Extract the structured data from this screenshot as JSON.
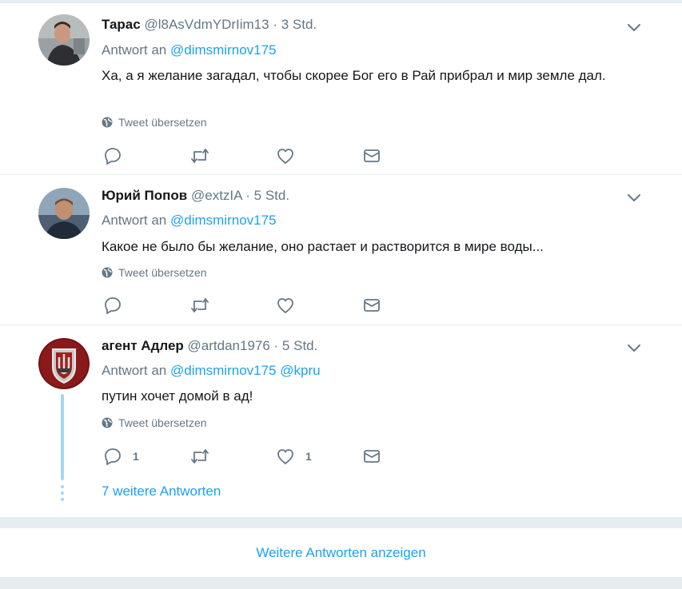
{
  "tweets": [
    {
      "name": "Тарас",
      "handle": "@l8AsVdmYDrIim13",
      "time": "· 3 Std.",
      "reply_prefix": "Antwort an",
      "mentions": [
        "@dimsmirnov175"
      ],
      "text": "Ха, а я желание загадал, чтобы скорее Бог его в Рай прибрал и мир земле дал.",
      "translate": "Tweet übersetzen",
      "reply_count": "",
      "like_count": ""
    },
    {
      "name": "Юрий Попов",
      "handle": "@extzIA",
      "time": "· 5 Std.",
      "reply_prefix": "Antwort an",
      "mentions": [
        "@dimsmirnov175"
      ],
      "text": "Какое не было бы желание, оно растает и растворится в мире воды...",
      "translate": "Tweet übersetzen",
      "reply_count": "",
      "like_count": ""
    },
    {
      "name": "агент Адлер",
      "handle": "@artdan1976",
      "time": "· 5 Std.",
      "reply_prefix": "Antwort an",
      "mentions": [
        "@dimsmirnov175",
        "@kpru"
      ],
      "text": "путин хочет домой в ад!",
      "translate": "Tweet übersetzen",
      "reply_count": "1",
      "like_count": "1"
    }
  ],
  "more_replies": "7 weitere Antworten",
  "show_more": "Weitere Antworten anzeigen",
  "colors": {
    "link": "#1da1f2",
    "muted": "#657786",
    "thread": "#a6d5f7",
    "separator": "#e6ecf0"
  },
  "icons": [
    "chevron-down-icon",
    "globe-icon",
    "reply-icon",
    "retweet-icon",
    "like-icon",
    "direct-message-icon"
  ]
}
